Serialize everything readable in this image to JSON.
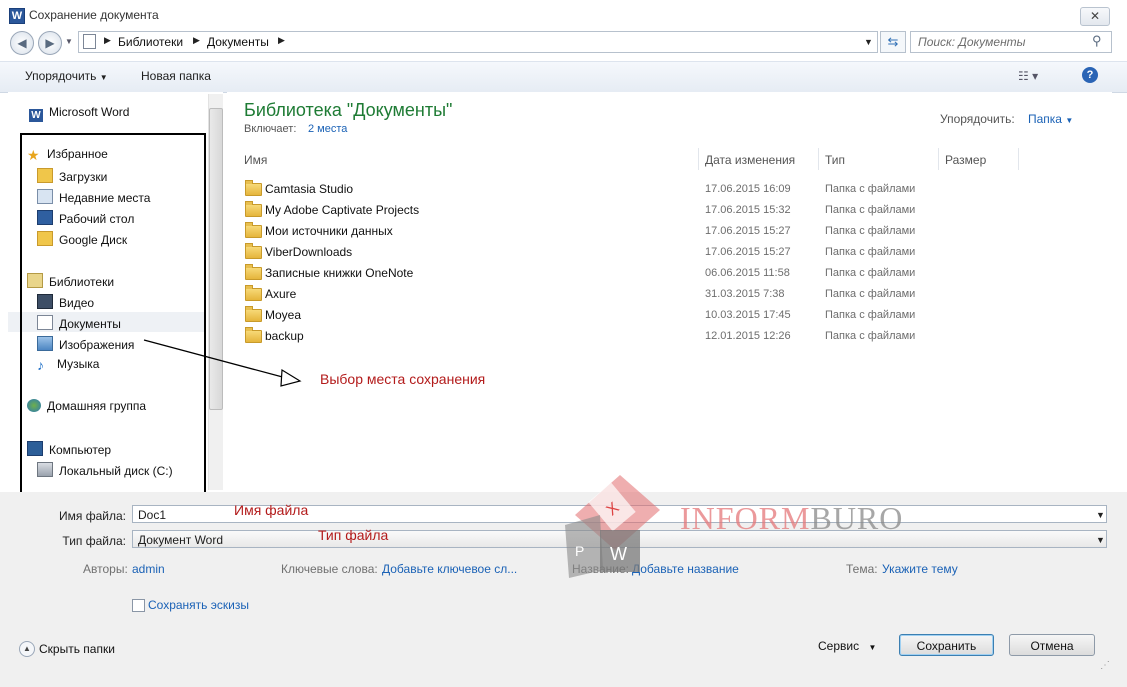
{
  "window": {
    "title": "Сохранение документа",
    "app_icon": "W",
    "close_label": "✕"
  },
  "address": {
    "crumbs": [
      "Библиотеки",
      "Документы"
    ],
    "search_placeholder": "Поиск: Документы"
  },
  "toolbar": {
    "organize_label": "Упорядочить",
    "new_folder_label": "Новая папка"
  },
  "nav": {
    "top_item": "Microsoft Word",
    "favorites": {
      "header": "Избранное",
      "items": [
        "Загрузки",
        "Недавние места",
        "Рабочий стол",
        "Google Диск"
      ]
    },
    "libraries": {
      "header": "Библиотеки",
      "items": [
        "Видео",
        "Документы",
        "Изображения",
        "Музыка"
      ]
    },
    "homegroup": "Домашняя группа",
    "computer": {
      "header": "Компьютер",
      "items": [
        "Локальный диск (C:)"
      ]
    },
    "selected": "Документы"
  },
  "content": {
    "library_title": "Библиотека \"Документы\"",
    "includes_label": "Включает:",
    "includes_link": "2 места",
    "sort_label": "Упорядочить:",
    "sort_value": "Папка",
    "columns": [
      "Имя",
      "Дата изменения",
      "Тип",
      "Размер"
    ],
    "rows": [
      {
        "name": "Camtasia Studio",
        "date": "17.06.2015 16:09",
        "type": "Папка с файлами"
      },
      {
        "name": "My Adobe Captivate Projects",
        "date": "17.06.2015 15:32",
        "type": "Папка с файлами"
      },
      {
        "name": "Мои источники данных",
        "date": "17.06.2015 15:27",
        "type": "Папка с файлами"
      },
      {
        "name": "ViberDownloads",
        "date": "17.06.2015 15:27",
        "type": "Папка с файлами"
      },
      {
        "name": "Записные книжки OneNote",
        "date": "06.06.2015 11:58",
        "type": "Папка с файлами"
      },
      {
        "name": "Axure",
        "date": "31.03.2015 7:38",
        "type": "Папка с файлами"
      },
      {
        "name": "Moyea",
        "date": "10.03.2015 17:45",
        "type": "Папка с файлами"
      },
      {
        "name": "backup",
        "date": "12.01.2015 12:26",
        "type": "Папка с файлами"
      }
    ]
  },
  "form": {
    "filename_label": "Имя файла:",
    "filename_value": "Doc1",
    "filetype_label": "Тип файла:",
    "filetype_value": "Документ Word",
    "authors_label": "Авторы:",
    "authors_value": "admin",
    "keywords_label": "Ключевые слова:",
    "keywords_value": "Добавьте ключевое сл...",
    "title_label": "Название:",
    "title_value": "Добавьте название",
    "subject_label": "Тема:",
    "subject_value": "Укажите тему",
    "thumbnails_label": "Сохранять эскизы"
  },
  "footer": {
    "hide_folders_label": "Скрыть папки",
    "tools_label": "Сервис",
    "save_label": "Сохранить",
    "cancel_label": "Отмена"
  },
  "annotations": {
    "location": "Выбор места сохранения",
    "filename": "Имя файла",
    "filetype": "Тип файла"
  },
  "watermark": {
    "part1": "INFORM",
    "part2": "BURO"
  },
  "colors": {
    "library_title": "#1e7b34",
    "link": "#1b62b6",
    "annotation": "#b31b1b"
  }
}
